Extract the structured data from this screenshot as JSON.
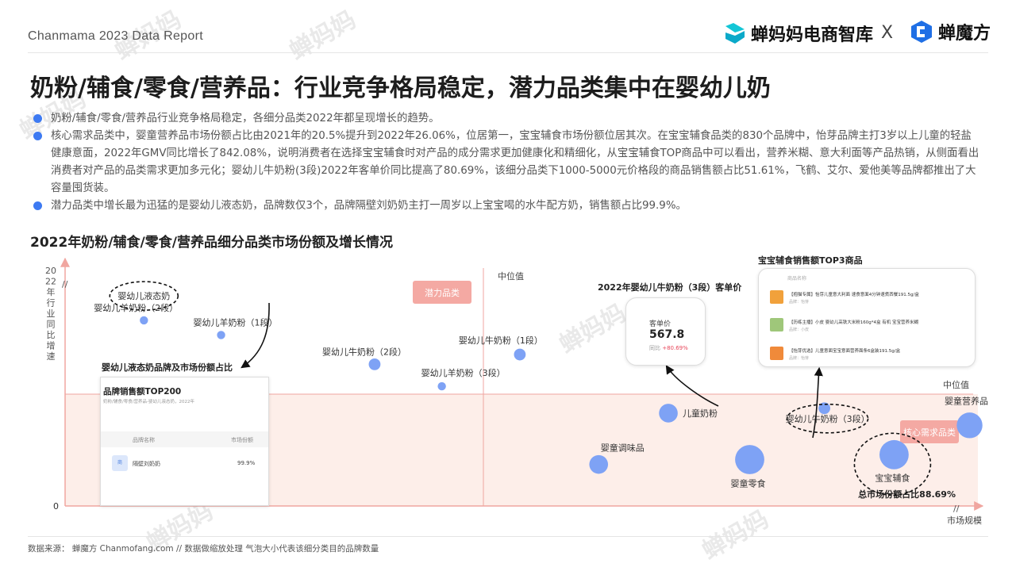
{
  "header": {
    "report_title": "Chanmama 2023 Data Report",
    "logo_left": "蝉妈妈电商智库",
    "separator": "X",
    "logo_right": "蝉魔方"
  },
  "headline": "奶粉/辅食/零食/营养品：行业竞争格局稳定，潜力品类集中在婴幼儿奶",
  "bullets": [
    "奶粉/辅食/零食/营养品行业竞争格局稳定，各细分品类2022年都呈现增长的趋势。",
    "核心需求品类中，婴童营养品市场份额占比由2021年的20.5%提升到2022年26.06%，位居第一，宝宝辅食市场份额位居其次。在宝宝辅食品类的830个品牌中，怡芽品牌主打3岁以上儿童的轻盐健康意面，2022年GMV同比增长了842.08%，说明消费者在选择宝宝辅食时对产品的成分需求更加健康化和精细化，从宝宝辅食TOP商品中可以看出，营养米糊、意大利面等产品热销，从侧面看出消费者对产品的品类需求更加多元化；婴幼儿牛奶粉(3段)2022年客单价同比提高了80.69%，该细分品类下1000-5000元价格段的商品销售额占比51.61%，飞鹤、艾尔、爱他美等品牌都推出了大容量囤货装。",
    "潜力品类中增长最为迅猛的是婴幼儿液态奶，品牌数仅3个，品牌隔壁刘奶奶主打一周岁以上宝宝喝的水牛配方奶，销售额占比99.9%。"
  ],
  "chart_title": "2022年奶粉/辅食/零食/营养品细分品类市场份额及增长情况",
  "chart_data": {
    "type": "scatter",
    "title": "2022年奶粉/辅食/零食/营养品细分品类市场份额及增长情况",
    "xlabel": "市场规模",
    "ylabel": "2022年同比增速",
    "y_origin_label": "0",
    "axis_break": "//",
    "x_mid_label": "中位值",
    "y_mid_label": "中位值",
    "quadrants": {
      "potential": "潜力品类",
      "core": "核心需求品类"
    },
    "total_share_note": "总市场份额占比88.69%",
    "note": "数据做缩放处理，气泡大小代表该细分类目的品牌数量",
    "points": [
      {
        "label": "婴幼儿液态奶",
        "x": 0.095,
        "y": 0.86,
        "size": 0,
        "highlight": true
      },
      {
        "label": "婴幼儿羊奶粉（2段）",
        "x": 0.095,
        "y": 0.76,
        "size": 1
      },
      {
        "label": "婴幼儿羊奶粉（1段）",
        "x": 0.188,
        "y": 0.7,
        "size": 1
      },
      {
        "label": "婴幼儿牛奶粉（2段）",
        "x": 0.373,
        "y": 0.58,
        "size": 2
      },
      {
        "label": "婴幼儿牛奶粉（1段）",
        "x": 0.548,
        "y": 0.62,
        "size": 2
      },
      {
        "label": "婴幼儿羊奶粉（3段）",
        "x": 0.454,
        "y": 0.49,
        "size": 1
      },
      {
        "label": "婴幼儿牛奶粉（3段）",
        "x": 0.915,
        "y": 0.4,
        "size": 2,
        "highlight": true
      },
      {
        "label": "儿童奶粉",
        "x": 0.727,
        "y": 0.38,
        "size": 4
      },
      {
        "label": "婴童调味品",
        "x": 0.643,
        "y": 0.17,
        "size": 4
      },
      {
        "label": "婴童零食",
        "x": 0.825,
        "y": 0.19,
        "size": 7
      },
      {
        "label": "宝宝辅食",
        "x": 0.999,
        "y": 0.21,
        "size": 7,
        "highlight": true
      },
      {
        "label": "婴童营养品",
        "x": 1.09,
        "y": 0.33,
        "size": 6
      }
    ],
    "colors": {
      "bubble": "#7ea2f5",
      "core_fill": "#fdeee9",
      "potential_tag": "#f4a9a3",
      "core_tag": "#f4a9a3",
      "axis": "#f0a6a0"
    }
  },
  "liquid_milk_card": {
    "label": "婴幼儿液态奶品牌及市场份额占比",
    "title": "品牌销售额TOP200",
    "subtitle": "奶粉/辅食/零食/营养品-婴幼儿液态奶，2022年",
    "col_brand": "品牌名称",
    "col_share": "市场份额",
    "brand_icon": "商",
    "brand": "隔壁刘奶奶",
    "share": "99.9%"
  },
  "price_card": {
    "heading": "2022年婴幼儿牛奶粉（3段）客单价",
    "label": "客单价",
    "value": "567.8",
    "change_label": "同比",
    "change_value": "+80.69%"
  },
  "top3_card": {
    "heading": "宝宝辅食销售额TOP3商品",
    "col": "商品名称",
    "items": [
      {
        "name": "【抱猫专属】怡芽儿童意大利面 速食意面4分钟速煮西餐191.5g/盒",
        "brand": "品牌：怡芽",
        "color": "#f1a13b"
      },
      {
        "name": "【历练主播】小皮 婴幼儿高铁大米粉160g*4盒 有机 宝宝营养米糊",
        "brand": "品牌：小皮",
        "color": "#9fc77a"
      },
      {
        "name": "【怡芽优选】儿童意面宝宝意面营养面条6盒装191.5g/盒",
        "brand": "品牌：怡芽",
        "color": "#f08a3a"
      }
    ]
  },
  "footer": "数据来源：  蝉魔方 Chanmofang.com // 数据做缩放处理    气泡大小代表该细分类目的品牌数量"
}
